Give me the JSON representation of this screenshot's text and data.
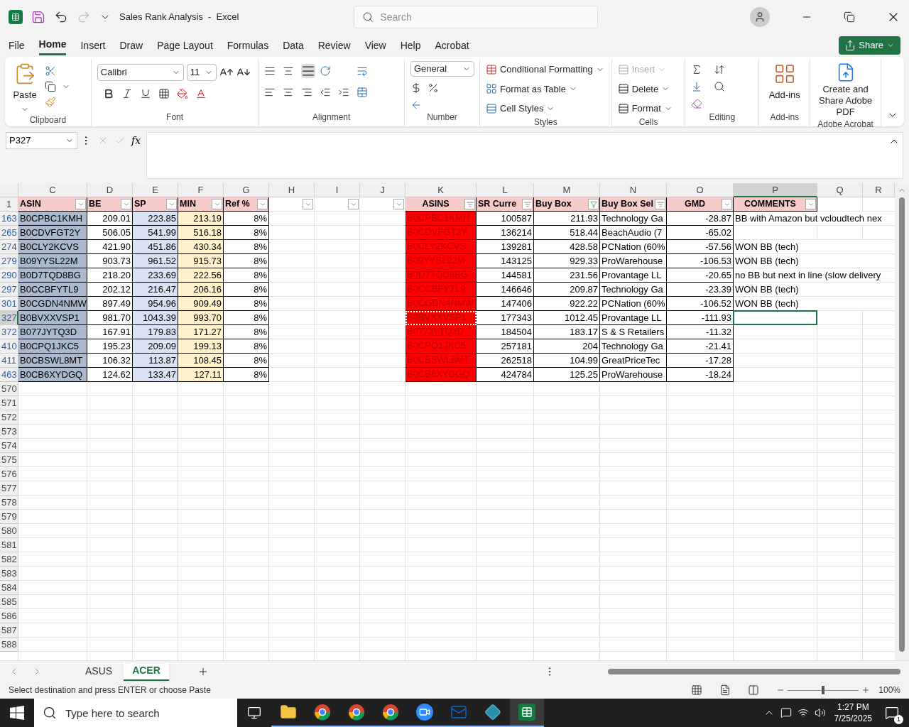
{
  "window": {
    "title": "Sales Rank Analysis  -  Excel",
    "search_placeholder": "Search"
  },
  "menu": [
    {
      "label": "File",
      "selected": false
    },
    {
      "label": "Home",
      "selected": true
    },
    {
      "label": "Insert",
      "selected": false
    },
    {
      "label": "Draw",
      "selected": false
    },
    {
      "label": "Page Layout",
      "selected": false
    },
    {
      "label": "Formulas",
      "selected": false
    },
    {
      "label": "Data",
      "selected": false
    },
    {
      "label": "Review",
      "selected": false
    },
    {
      "label": "View",
      "selected": false
    },
    {
      "label": "Help",
      "selected": false
    },
    {
      "label": "Acrobat",
      "selected": false
    }
  ],
  "share": "Share",
  "ribbon": {
    "clipboard": {
      "paste": "Paste",
      "label": "Clipboard"
    },
    "font": {
      "name": "Calibri",
      "size": "11",
      "label": "Font"
    },
    "alignment": {
      "label": "Alignment"
    },
    "number": {
      "format": "General",
      "label": "Number"
    },
    "styles": {
      "items": [
        "Conditional Formatting",
        "Format as Table",
        "Cell Styles"
      ],
      "label": "Styles"
    },
    "cells": {
      "items": [
        {
          "label": "Insert",
          "disabled": true
        },
        {
          "label": "Delete",
          "disabled": false
        },
        {
          "label": "Format",
          "disabled": false
        }
      ],
      "label": "Cells"
    },
    "editing": {
      "label": "Editing"
    },
    "addins": {
      "button": "Add-ins",
      "label": "Add-ins"
    },
    "acrobat": {
      "button": "Create and Share Adobe PDF",
      "label": "Adobe Acrobat"
    }
  },
  "formula_bar": {
    "name_box": "P327",
    "fx": "fx"
  },
  "columns": [
    {
      "label": "C",
      "selected": false
    },
    {
      "label": "D",
      "selected": false
    },
    {
      "label": "E",
      "selected": false
    },
    {
      "label": "F",
      "selected": false
    },
    {
      "label": "G",
      "selected": false
    },
    {
      "label": "H",
      "selected": false
    },
    {
      "label": "I",
      "selected": false
    },
    {
      "label": "J",
      "selected": false
    },
    {
      "label": "K",
      "selected": false
    },
    {
      "label": "L",
      "selected": false
    },
    {
      "label": "M",
      "selected": false
    },
    {
      "label": "N",
      "selected": false
    },
    {
      "label": "O",
      "selected": false
    },
    {
      "label": "P",
      "selected": true
    },
    {
      "label": "Q",
      "selected": false
    },
    {
      "label": "R",
      "selected": false
    }
  ],
  "header_row": "1",
  "headers": [
    {
      "label": "ASIN",
      "kind": "plain"
    },
    {
      "label": "BE",
      "kind": "plain"
    },
    {
      "label": "SP",
      "kind": "plain"
    },
    {
      "label": "MIN",
      "kind": "plain"
    },
    {
      "label": "Ref %",
      "kind": "plain"
    },
    {
      "kind": "plain"
    },
    {
      "kind": "plain"
    },
    {
      "kind": "plain"
    },
    {
      "label": "ASINS",
      "kind": "filtered"
    },
    {
      "label": "SR Curre",
      "kind": "filtered"
    },
    {
      "label": "Buy Box",
      "kind": "sorted"
    },
    {
      "label": "Buy Box Sel",
      "kind": "filtered"
    },
    {
      "label": "GMD",
      "kind": "plain"
    },
    {
      "label": "COMMENTS",
      "kind": "plain"
    }
  ],
  "rows": [
    {
      "row": "163",
      "asin": "B0CPBC1KMH",
      "be": "209.01",
      "sp": "223.85",
      "min": "213.19",
      "ref": "8%",
      "asins": "B0CPBC1KMH",
      "sr": "100587",
      "buy_box": "211.93",
      "seller": "Technology Ga",
      "gmd": "-28.87",
      "comment": "BB with Amazon but vcloudtech nex",
      "selected": false,
      "copied": false
    },
    {
      "row": "265",
      "asin": "B0CDVFGT2Y",
      "be": "506.05",
      "sp": "541.99",
      "min": "516.18",
      "ref": "8%",
      "asins": "B0CDVFGT2Y",
      "sr": "136214",
      "buy_box": "518.44",
      "seller": "BeachAudio (7",
      "gmd": "-65.02",
      "selected": false,
      "copied": false
    },
    {
      "row": "274",
      "asin": "B0CLY2KCVS",
      "be": "421.90",
      "sp": "451.86",
      "min": "430.34",
      "ref": "8%",
      "asins": "B0CLY2KCVS",
      "sr": "139281",
      "buy_box": "428.58",
      "seller": "PCNation (60%",
      "gmd": "-57.56",
      "comment": "WON BB (tech)",
      "selected": false,
      "copied": false
    },
    {
      "row": "279",
      "asin": "B09YYSL22M",
      "be": "903.73",
      "sp": "961.52",
      "min": "915.73",
      "ref": "8%",
      "asins": "B09YYSL22M",
      "sr": "143125",
      "buy_box": "929.33",
      "seller": "ProWarehouse",
      "gmd": "-106.53",
      "comment": "WON BB (tech)",
      "selected": false,
      "copied": false
    },
    {
      "row": "290",
      "asin": "B0D7TQD8BG",
      "be": "218.20",
      "sp": "233.69",
      "min": "222.56",
      "ref": "8%",
      "asins": "B0D7TQD8BG",
      "sr": "144581",
      "buy_box": "231.56",
      "seller": "Provantage LL",
      "gmd": "-20.65",
      "comment": "no BB but next in line (slow delivery",
      "selected": false,
      "copied": false
    },
    {
      "row": "297",
      "asin": "B0CCBFYTL9",
      "be": "202.12",
      "sp": "216.47",
      "min": "206.16",
      "ref": "8%",
      "asins": "B0CCBFYTL9",
      "sr": "146646",
      "buy_box": "209.87",
      "seller": "Technology Ga",
      "gmd": "-23.39",
      "comment": "WON BB (tech)",
      "selected": false,
      "copied": false
    },
    {
      "row": "301",
      "asin": "B0CGDN4NMW",
      "be": "897.49",
      "sp": "954.96",
      "min": "909.49",
      "ref": "8%",
      "asins": "B0CGDN4NMW",
      "sr": "147406",
      "buy_box": "922.22",
      "seller": "PCNation (60%",
      "gmd": "-106.52",
      "comment": "WON BB (tech)",
      "selected": false,
      "copied": false
    },
    {
      "row": "327",
      "asin": "B0BVXXVSP1",
      "be": "981.70",
      "sp": "1043.39",
      "min": "993.70",
      "ref": "8%",
      "asins": "B0BVXXVSP1",
      "sr": "177343",
      "buy_box": "1012.45",
      "seller": "Provantage LL",
      "gmd": "-111.93",
      "selected": true,
      "copied": true
    },
    {
      "row": "372",
      "asin": "B077JYTQ3D",
      "be": "167.91",
      "sp": "179.83",
      "min": "171.27",
      "ref": "8%",
      "asins": "B077JYTQ3D",
      "sr": "184504",
      "buy_box": "183.17",
      "seller": "S & S Retailers",
      "gmd": "-11.32",
      "selected": false,
      "copied": false
    },
    {
      "row": "410",
      "asin": "B0CPQ1JKC5",
      "be": "195.23",
      "sp": "209.09",
      "min": "199.13",
      "ref": "8%",
      "asins": "B0CPQ1JKC5",
      "sr": "257181",
      "buy_box": "204",
      "seller": "Technology Ga",
      "gmd": "-21.41",
      "selected": false,
      "copied": false
    },
    {
      "row": "411",
      "asin": "B0CBSWL8MT",
      "be": "106.32",
      "sp": "113.87",
      "min": "108.45",
      "ref": "8%",
      "asins": "B0CBSWL8MT",
      "sr": "262518",
      "buy_box": "104.99",
      "seller": "GreatPriceTec",
      "gmd": "-17.28",
      "selected": false,
      "copied": false
    },
    {
      "row": "463",
      "asin": "B0CB6XYDGQ",
      "be": "124.62",
      "sp": "133.47",
      "min": "127.11",
      "ref": "8%",
      "asins": "B0CB6XYDGQ",
      "sr": "424784",
      "buy_box": "125.25",
      "seller": "ProWarehouse",
      "gmd": "-18.24",
      "selected": false,
      "copied": false
    }
  ],
  "empty_rows": [
    "570",
    "571",
    "572",
    "573",
    "574",
    "575",
    "576",
    "577",
    "578",
    "579",
    "580",
    "581",
    "582",
    "583",
    "584",
    "585",
    "586",
    "587",
    "588"
  ],
  "sheets": [
    {
      "label": "ASUS",
      "selected": false
    },
    {
      "label": "ACER",
      "selected": true
    }
  ],
  "status": {
    "message": "Select destination and press ENTER or choose Paste",
    "zoom": "100%",
    "level": 0.5
  },
  "taskbar": {
    "search_placeholder": "Type here to search",
    "time": "1:27 PM",
    "date": "7/25/2025",
    "notifications": "1",
    "apps": [
      {
        "kind": "folder",
        "active": false
      },
      {
        "kind": "chrome",
        "active": false
      },
      {
        "kind": "chrome",
        "active": false
      },
      {
        "kind": "chrome",
        "active": false
      },
      {
        "kind": "zoom",
        "active": false
      },
      {
        "kind": "outlook",
        "active": false
      },
      {
        "kind": "diamond",
        "active": false
      },
      {
        "kind": "excel",
        "active": true
      }
    ]
  }
}
